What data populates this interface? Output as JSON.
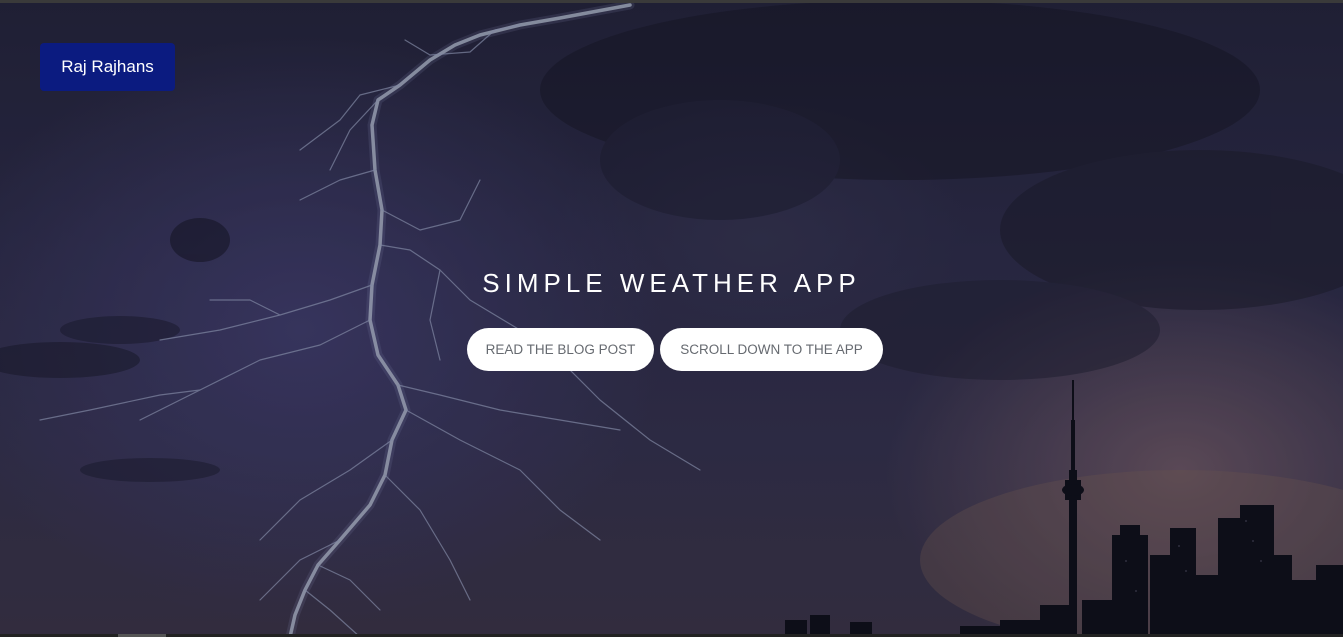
{
  "nav": {
    "brand_label": "Raj Rajhans"
  },
  "hero": {
    "title": "SIMPLE WEATHER APP",
    "buttons": [
      {
        "label": "READ THE BLOG POST"
      },
      {
        "label": "SCROLL DOWN TO THE APP"
      }
    ]
  },
  "colors": {
    "brand_bg": "#0b1b80",
    "button_bg": "#ffffff",
    "button_text": "#666a70",
    "title_text": "#ffffff"
  },
  "icons": {
    "background": "storm-lightning-city-skyline-image"
  }
}
